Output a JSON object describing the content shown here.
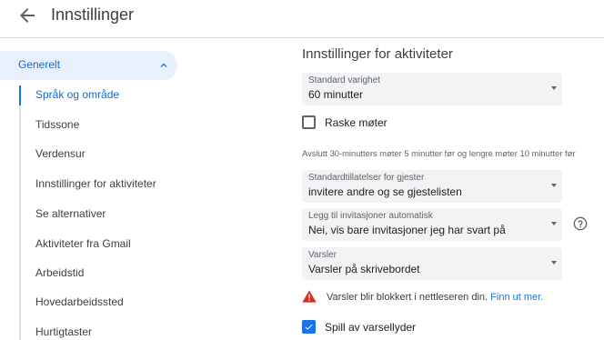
{
  "header": {
    "title": "Innstillinger"
  },
  "sidebar": {
    "group_label": "Generelt",
    "items": [
      {
        "label": "Språk og område",
        "active": true
      },
      {
        "label": "Tidssone"
      },
      {
        "label": "Verdensur"
      },
      {
        "label": "Innstillinger for aktiviteter"
      },
      {
        "label": "Se alternativer"
      },
      {
        "label": "Aktiviteter fra Gmail"
      },
      {
        "label": "Arbeidstid"
      },
      {
        "label": "Hovedarbeidssted"
      },
      {
        "label": "Hurtigtaster"
      }
    ]
  },
  "main": {
    "section_title": "Innstillinger for aktiviteter",
    "default_duration": {
      "label": "Standard varighet",
      "value": "60 minutter"
    },
    "quick_meetings": {
      "label": "Raske møter",
      "checked": false
    },
    "quick_meetings_hint": "Avslutt 30-minutters møter 5 minutter før og lengre møter 10 minutter før",
    "guest_permissions": {
      "label": "Standardtillatelser for gjester",
      "value": "invitere andre og se gjestelisten"
    },
    "auto_add_invites": {
      "label": "Legg til invitasjoner automatisk",
      "value": "Nei, vis bare invitasjoner jeg har svart på"
    },
    "notifications": {
      "label": "Varsler",
      "value": "Varsler på skrivebordet"
    },
    "warning": {
      "text": "Varsler blir blokkert i nettleseren din.",
      "link": "Finn ut mer."
    },
    "play_sounds": {
      "label": "Spill av varsellyder",
      "checked": true
    }
  },
  "colors": {
    "accent": "#1a73e8",
    "active_text": "#1967d2",
    "active_bg": "#e8f0fe",
    "warning": "#d93025"
  },
  "icons": [
    "back-arrow-icon",
    "chevron-up-icon",
    "dropdown-arrow-icon",
    "help-icon",
    "warning-icon",
    "checkmark-icon"
  ]
}
